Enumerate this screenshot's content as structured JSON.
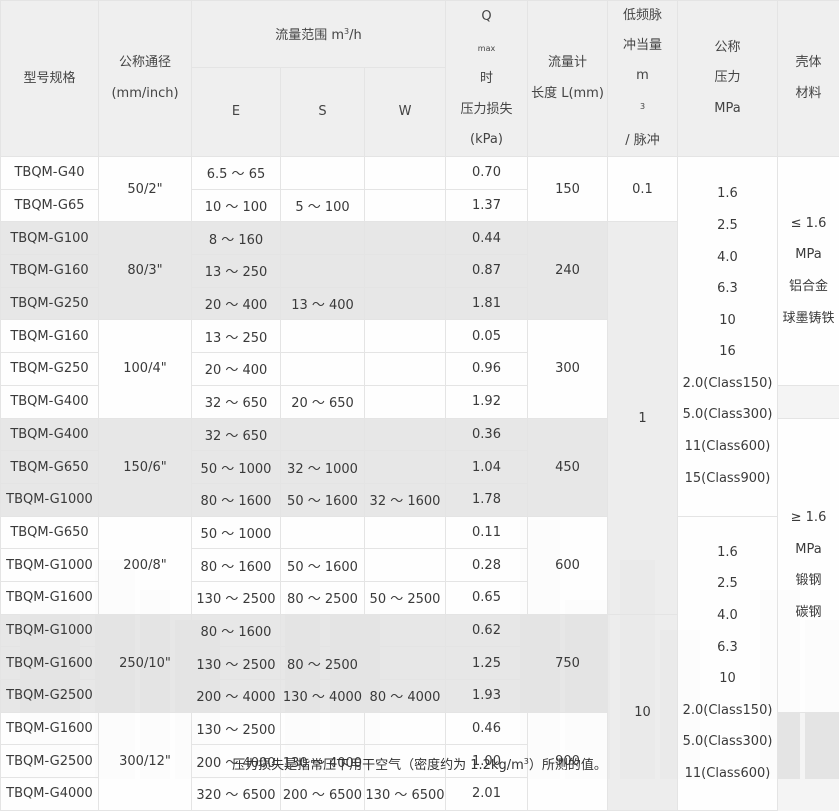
{
  "header": {
    "model": "型号规格",
    "diameter": [
      "公称通径",
      "(mm/inch)"
    ],
    "flow_range": "流量范围 m",
    "flow_range_unit_exp": "3",
    "flow_range_suffix": "/h",
    "sub_e": "E",
    "sub_s": "S",
    "sub_w": "W",
    "qmax_prefix": "Q",
    "qmax_sub": "max",
    "qmax_suffix": " 时",
    "pressure_loss": "压力损失",
    "pressure_loss_unit": "(kPa)",
    "meter_length": [
      "流量计",
      "长度 L(mm)"
    ],
    "pulse": [
      "低频脉",
      "冲当量"
    ],
    "pulse_unit_m": "m",
    "pulse_unit_exp": "3",
    "pulse_unit_suffix": "/ 脉冲",
    "nominal_pressure": [
      "公称",
      "压力",
      "MPa"
    ],
    "housing": [
      "壳体",
      "材料"
    ]
  },
  "groups": [
    {
      "diameter": "50/2\"",
      "length": "150",
      "rows": [
        {
          "model": "TBQM-G40",
          "e": "6.5 ～ 65",
          "s": "",
          "w": "",
          "loss": "0.70"
        },
        {
          "model": "TBQM-G65",
          "e": "10 ～ 100",
          "s": "5 ～ 100",
          "w": "",
          "loss": "1.37"
        }
      ]
    },
    {
      "diameter": "80/3\"",
      "length": "240",
      "rows": [
        {
          "model": "TBQM-G100",
          "e": "8 ～ 160",
          "s": "",
          "w": "",
          "loss": "0.44"
        },
        {
          "model": "TBQM-G160",
          "e": "13 ～ 250",
          "s": "",
          "w": "",
          "loss": "0.87"
        },
        {
          "model": "TBQM-G250",
          "e": "20 ～ 400",
          "s": "13 ～ 400",
          "w": "",
          "loss": "1.81"
        }
      ]
    },
    {
      "diameter": "100/4\"",
      "length": "300",
      "rows": [
        {
          "model": "TBQM-G160",
          "e": "13 ～ 250",
          "s": "",
          "w": "",
          "loss": "0.05"
        },
        {
          "model": "TBQM-G250",
          "e": "20 ～ 400",
          "s": "",
          "w": "",
          "loss": "0.96"
        },
        {
          "model": "TBQM-G400",
          "e": "32 ～ 650",
          "s": "20 ～ 650",
          "w": "",
          "loss": "1.92"
        }
      ]
    },
    {
      "diameter": "150/6\"",
      "length": "450",
      "rows": [
        {
          "model": "TBQM-G400",
          "e": "32 ～ 650",
          "s": "",
          "w": "",
          "loss": "0.36"
        },
        {
          "model": "TBQM-G650",
          "e": "50 ～ 1000",
          "s": "32 ～ 1000",
          "w": "",
          "loss": "1.04"
        },
        {
          "model": "TBQM-G1000",
          "e": "80 ～ 1600",
          "s": "50 ～ 1600",
          "w": "32 ～ 1600",
          "loss": "1.78"
        }
      ]
    },
    {
      "diameter": "200/8\"",
      "length": "600",
      "rows": [
        {
          "model": "TBQM-G650",
          "e": "50 ～ 1000",
          "s": "",
          "w": "",
          "loss": "0.11"
        },
        {
          "model": "TBQM-G1000",
          "e": "80 ～ 1600",
          "s": "50 ～ 1600",
          "w": "",
          "loss": "0.28"
        },
        {
          "model": "TBQM-G1600",
          "e": "130 ～ 2500",
          "s": "80 ～ 2500",
          "w": "50 ～ 2500",
          "loss": "0.65"
        }
      ]
    },
    {
      "diameter": "250/10\"",
      "length": "750",
      "rows": [
        {
          "model": "TBQM-G1000",
          "e": "80 ～ 1600",
          "s": "",
          "w": "",
          "loss": "0.62"
        },
        {
          "model": "TBQM-G1600",
          "e": "130 ～ 2500",
          "s": "80 ～ 2500",
          "w": "",
          "loss": "1.25"
        },
        {
          "model": "TBQM-G2500",
          "e": "200 ～ 4000",
          "s": "130 ～ 4000",
          "w": "80 ～ 4000",
          "loss": "1.93"
        }
      ]
    },
    {
      "diameter": "300/12\"",
      "length": "900",
      "rows": [
        {
          "model": "TBQM-G1600",
          "e": "130 ～ 2500",
          "s": "",
          "w": "",
          "loss": "0.46"
        },
        {
          "model": "TBQM-G2500",
          "e": "200 ～ 4000",
          "s": "130 ～ 4000",
          "w": "",
          "loss": "1.00"
        },
        {
          "model": "TBQM-G4000",
          "e": "320 ～ 6500",
          "s": "200 ～ 6500",
          "w": "130 ～ 6500",
          "loss": "2.01"
        }
      ]
    }
  ],
  "pulse_values": [
    "0.1",
    "1",
    "10"
  ],
  "pressure_block_1": [
    "1.6",
    "2.5",
    "4.0",
    "6.3",
    "10",
    "16",
    "2.0(Class150)",
    "5.0(Class300)",
    "11(Class600)",
    "15(Class900)"
  ],
  "pressure_block_2": [
    "1.6",
    "2.5",
    "4.0",
    "6.3",
    "10",
    "2.0(Class150)",
    "5.0(Class300)",
    "11(Class600)"
  ],
  "housing_block_1": [
    "≤ 1.6",
    "MPa",
    "铝合金",
    "球墨铸铁"
  ],
  "housing_block_2": [
    "≥ 1.6",
    "MPa",
    "锻钢",
    "碳钢"
  ],
  "housing_block_3": [
    "碳钢"
  ],
  "footnote_prefix": "压力损失是指常压下用干空气（密度约为 1.2kg/m",
  "footnote_exp": "3",
  "footnote_suffix": "）所测的值。"
}
